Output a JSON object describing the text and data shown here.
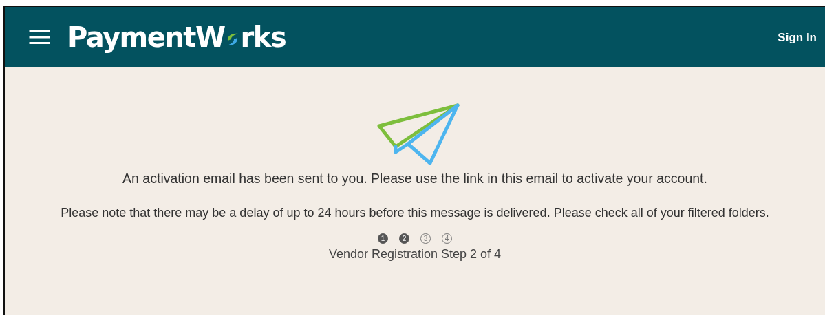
{
  "header": {
    "logo": {
      "before": "PaymentW",
      "after": "rks"
    },
    "sign_in": "Sign In"
  },
  "message": "An activation email has been sent to you. Please use the link in this email to activate your account.",
  "note": "Please note that there may be a delay of up to 24 hours before this message is delivered. Please check all of your filtered folders.",
  "steps": [
    {
      "label": "1",
      "done": true
    },
    {
      "label": "2",
      "done": true
    },
    {
      "label": "3",
      "done": false
    },
    {
      "label": "4",
      "done": false
    }
  ],
  "step_caption": "Vendor Registration Step 2 of 4"
}
